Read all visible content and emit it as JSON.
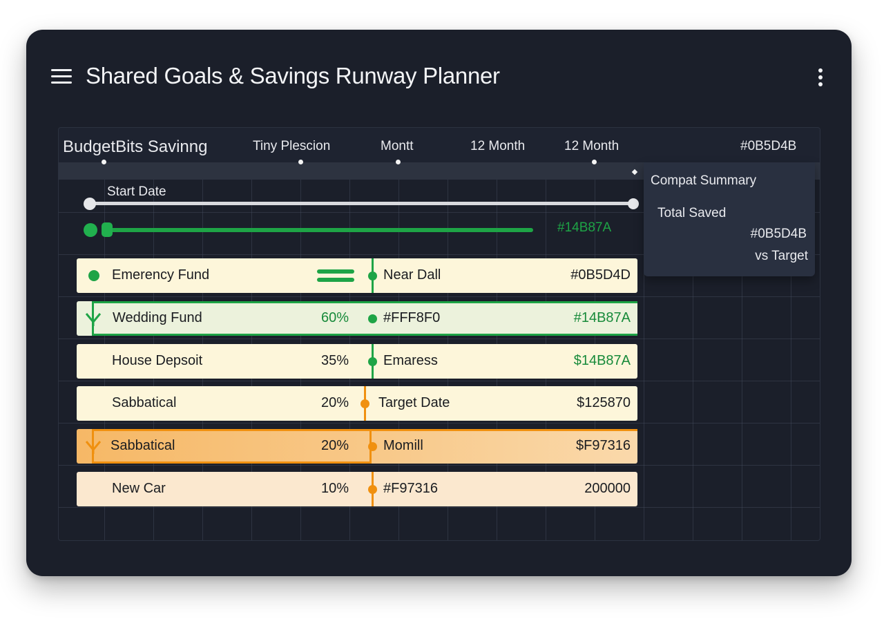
{
  "app": {
    "title": "Shared Goals & Savings Runway Planner"
  },
  "timeline": {
    "brand": "BudgetBits Savinng",
    "columns": [
      "Tiny Plescion",
      "Montt",
      "12 Month",
      "12 Month"
    ],
    "header_right": "#0B5D4B",
    "start_label": "Start Date",
    "green_label": "#14B87A"
  },
  "summary": {
    "title": "Compat Summary",
    "total_label": "Total Saved",
    "total_value": "#0B5D4B",
    "vs_label": "vs Target"
  },
  "goals": [
    {
      "name": "Emerency Fund",
      "percent": "",
      "mid": "Near Dall",
      "right": "#0B5D4D",
      "status": "green",
      "icon": "green-dot-icon"
    },
    {
      "name": "Wedding Fund",
      "percent": "60%",
      "mid": "#FFF8F0",
      "right": "#14B87A",
      "status": "green-selected",
      "icon": "chevron-down-icon"
    },
    {
      "name": "House Depsoit",
      "percent": "35%",
      "mid": "Emaress",
      "right": "$14B87A",
      "status": "green",
      "icon": ""
    },
    {
      "name": "Sabbatical",
      "percent": "20%",
      "mid": "Target Date",
      "right": "$125870",
      "status": "orange",
      "icon": ""
    },
    {
      "name": "Sabbatical",
      "percent": "20%",
      "mid": "Momill",
      "right": "$F97316",
      "status": "orange-selected",
      "icon": "chevron-down-icon"
    },
    {
      "name": "New Car",
      "percent": "10%",
      "mid": "#F97316",
      "right": "200000",
      "status": "orange",
      "icon": ""
    }
  ],
  "colors": {
    "background": "#1b1f2a",
    "green": "#1ea446",
    "green_text": "#178a3a",
    "orange": "#f0900f",
    "row_cream": "#fdf6da",
    "row_green_selected": "#ecf2dc",
    "row_orange_selected": "#f7c983",
    "row_peach": "#fbe8cf"
  }
}
